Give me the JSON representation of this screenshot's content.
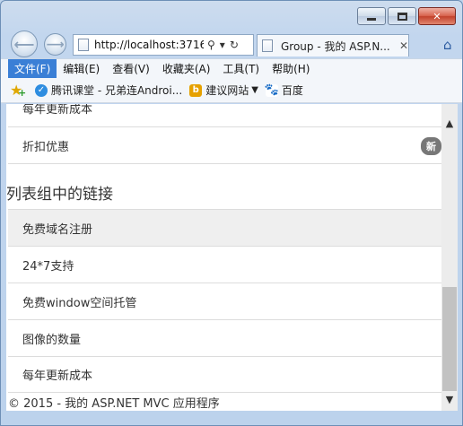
{
  "window": {
    "minimize_icon": "minimize-icon",
    "maximize_icon": "maximize-icon",
    "close_label": "✕"
  },
  "nav": {
    "back_glyph": "⟵",
    "forward_glyph": "⟶",
    "address": "http://localhost:3716",
    "search_glyph": "⚲",
    "dropdown_glyph": "▾",
    "refresh_glyph": "↻",
    "tab_title": "Group - 我的 ASP.N...",
    "tab_close": "✕",
    "home_glyph": "⌂"
  },
  "menubar": {
    "items": [
      "文件(F)",
      "编辑(E)",
      "查看(V)",
      "收藏夹(A)",
      "工具(T)",
      "帮助(H)"
    ]
  },
  "favorites": {
    "links": [
      {
        "label": "腾讯课堂 - 兄弟连Androi...",
        "icon": "tencent-classroom-icon"
      },
      {
        "label": "建议网站",
        "icon": "bing-icon",
        "dropdown": "▼"
      },
      {
        "label": "百度",
        "icon": "baidu-paw-icon"
      }
    ]
  },
  "content": {
    "top_partial_item": "每年更新成本",
    "discount_item": "折扣优惠",
    "discount_badge": "新",
    "section_heading": "列表组中的链接",
    "link_items": [
      "免费域名注册",
      "24*7支持",
      "免费window空间托管",
      "图像的数量",
      "每年更新成本"
    ],
    "footer": "© 2015 - 我的 ASP.NET MVC 应用程序"
  },
  "scrollbar": {
    "up_glyph": "▲",
    "down_glyph": "▼",
    "thumb_position": 0.68
  },
  "colors": {
    "menu_active": "#3a7fd6",
    "badge": "#777777",
    "close_button": "#c2412b"
  }
}
